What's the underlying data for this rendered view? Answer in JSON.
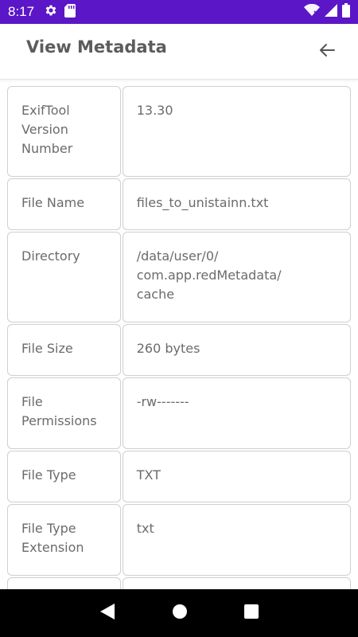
{
  "status_bar": {
    "time": "8:17",
    "background": "#5b16c8",
    "icons_left": [
      "gear-icon",
      "sd-card-icon"
    ],
    "icons_right": [
      "wifi-icon",
      "signal-icon",
      "battery-icon"
    ]
  },
  "app_bar": {
    "title": "View Metadata",
    "back_icon": "arrow-left-icon"
  },
  "metadata": {
    "rows": [
      {
        "key": "ExifTool\nVersion\nNumber",
        "value": "13.30"
      },
      {
        "key": "File Name",
        "value": "files_to_unistainn.txt"
      },
      {
        "key": "Directory",
        "value": "/data/user/0/\ncom.app.redMetadata/\ncache"
      },
      {
        "key": "File Size",
        "value": "260 bytes"
      },
      {
        "key": "File\nPermissions",
        "value": "-rw-------"
      },
      {
        "key": "File Type",
        "value": "TXT"
      },
      {
        "key": "File Type\nExtension",
        "value": "txt"
      },
      {
        "key": "",
        "value": ""
      }
    ]
  },
  "nav_bar": {
    "buttons": [
      "back-triangle-icon",
      "home-circle-icon",
      "recents-square-icon"
    ]
  }
}
